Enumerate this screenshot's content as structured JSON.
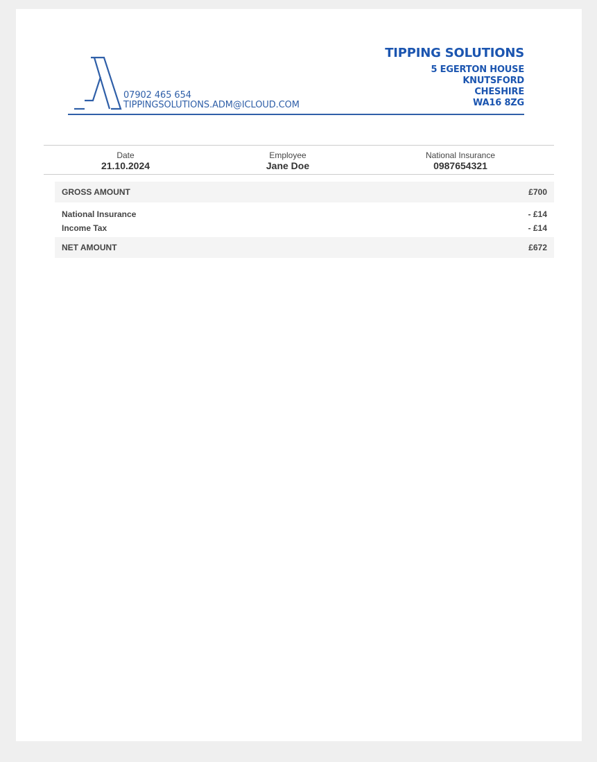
{
  "company": {
    "name": "TIPPING SOLUTIONS",
    "address": [
      "5 EGERTON HOUSE",
      "KNUTSFORD",
      "CHESHIRE",
      "WA16 8ZG"
    ],
    "phone": "07902 465 654",
    "email": "TIPPINGSOLUTIONS.ADM@ICLOUD.COM",
    "brand_color": "#1b55b0"
  },
  "info": {
    "date_label": "Date",
    "date_value": "21.10.2024",
    "employee_label": "Employee",
    "employee_value": "Jane Doe",
    "ni_label": "National Insurance",
    "ni_value": "0987654321"
  },
  "amounts": {
    "gross_label": "GROSS AMOUNT",
    "gross_value": "£700",
    "deductions": [
      {
        "label": "National Insurance",
        "value": "- £14"
      },
      {
        "label": "Income Tax",
        "value": "- £14"
      }
    ],
    "net_label": "NET AMOUNT",
    "net_value": "£672"
  }
}
